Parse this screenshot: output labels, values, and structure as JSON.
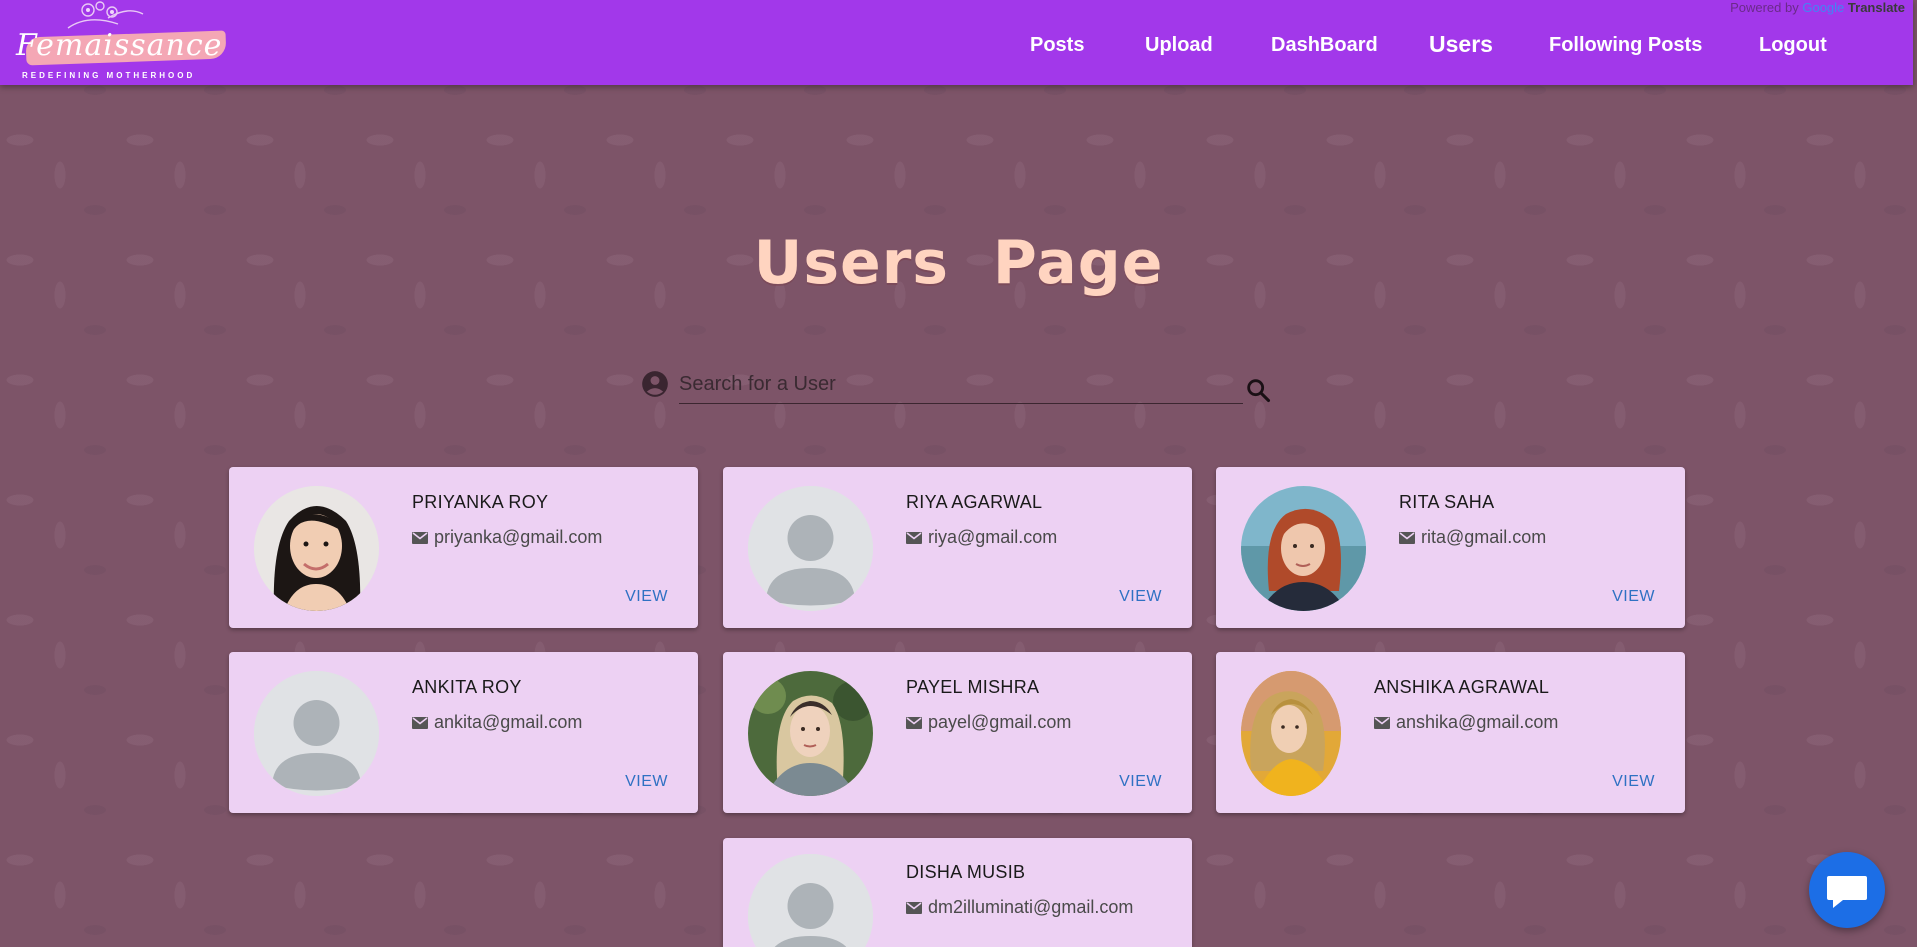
{
  "nav": {
    "logo_text": "Femaissance",
    "logo_tagline": "REDEFINING MOTHERHOOD",
    "links": [
      {
        "label": "Posts"
      },
      {
        "label": "Upload"
      },
      {
        "label": "DashBoard"
      },
      {
        "label": "Users",
        "active": true
      },
      {
        "label": "Following Posts"
      },
      {
        "label": "Logout"
      }
    ],
    "powered_by": "Powered by",
    "google": "Google",
    "translate": "Translate"
  },
  "page": {
    "title": "Users Page"
  },
  "search": {
    "placeholder": "Search for a User",
    "value": ""
  },
  "users": [
    {
      "name": "PRIYANKA ROY",
      "email": "priyanka@gmail.com",
      "view_label": "VIEW",
      "avatar": "photo"
    },
    {
      "name": "RIYA AGARWAL",
      "email": "riya@gmail.com",
      "view_label": "VIEW",
      "avatar": "placeholder"
    },
    {
      "name": "RITA SAHA",
      "email": "rita@gmail.com",
      "view_label": "VIEW",
      "avatar": "photo"
    },
    {
      "name": "ANKITA ROY",
      "email": "ankita@gmail.com",
      "view_label": "VIEW",
      "avatar": "placeholder"
    },
    {
      "name": "PAYEL MISHRA",
      "email": "payel@gmail.com",
      "view_label": "VIEW",
      "avatar": "photo"
    },
    {
      "name": "ANSHIKA AGRAWAL",
      "email": "anshika@gmail.com",
      "view_label": "VIEW",
      "avatar": "photo"
    },
    {
      "name": "DISHA MUSIB",
      "email": "dm2illuminati@gmail.com",
      "view_label": "VIEW",
      "avatar": "placeholder"
    }
  ],
  "colors": {
    "navbar": "#a238ea",
    "card": "#edd1f3",
    "title": "#ffd4c0",
    "link": "#2f71c3",
    "chat_button": "#1c6ee6"
  },
  "icons": {
    "account": "account-circle-icon",
    "search": "search-icon",
    "mail": "mail-icon",
    "chat": "chat-icon"
  }
}
